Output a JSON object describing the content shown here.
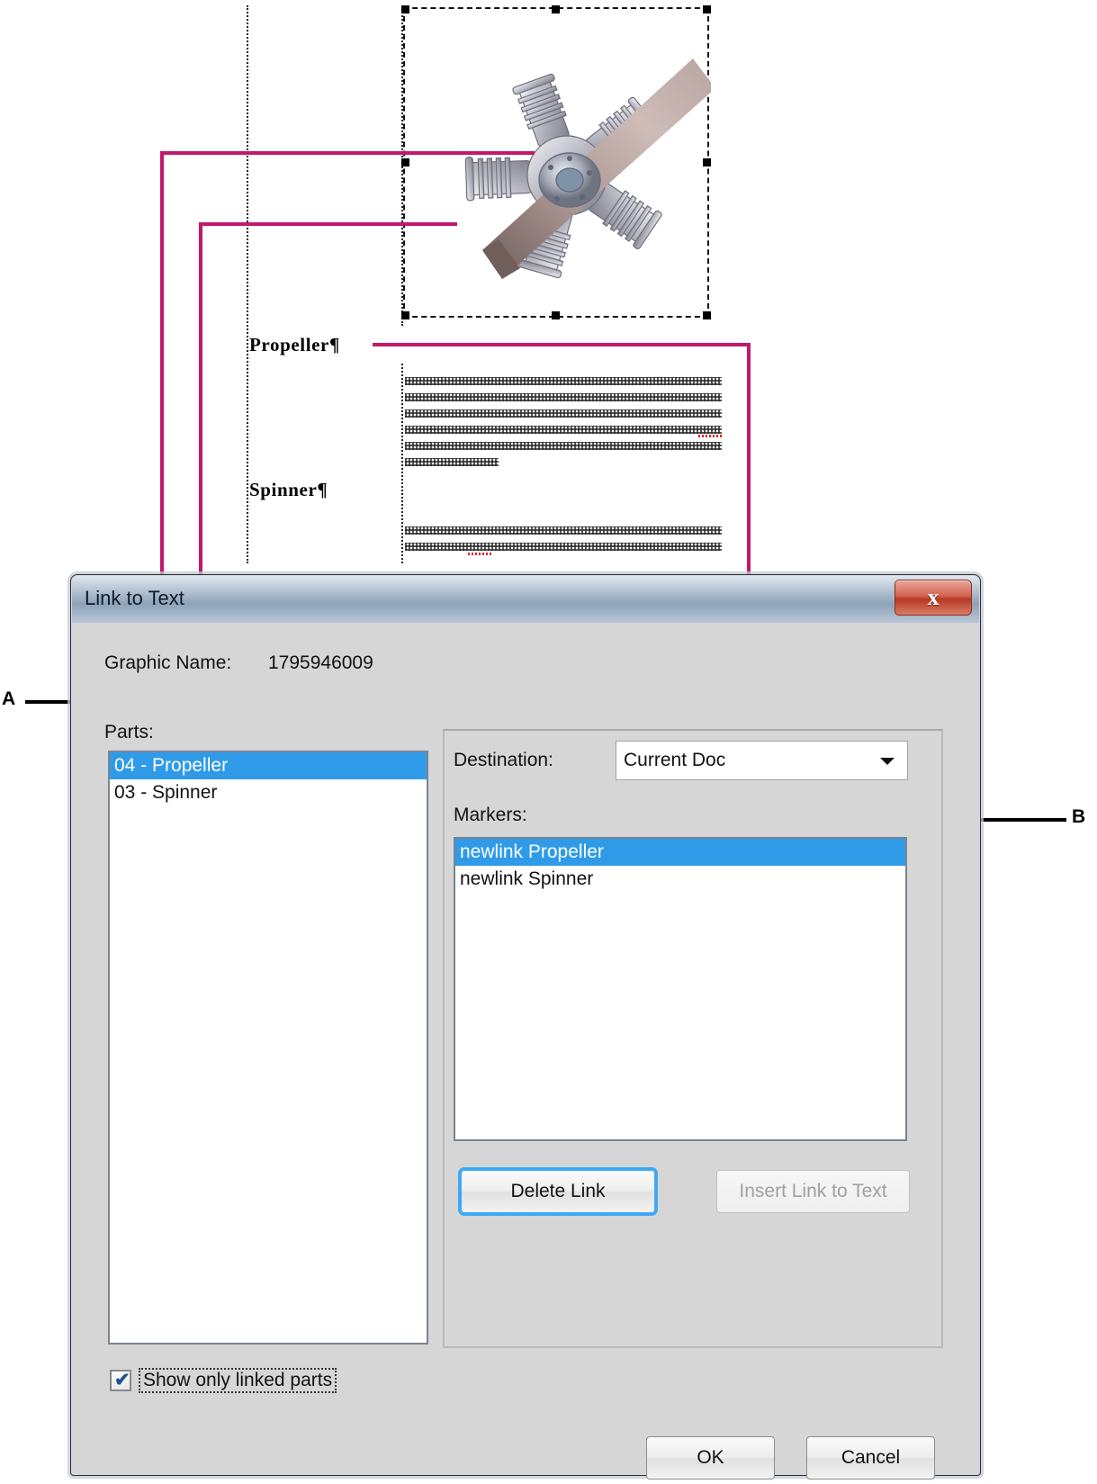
{
  "document": {
    "headings": [
      {
        "text": "Propeller",
        "pilcrow": "¶"
      },
      {
        "text": "Spinner",
        "pilcrow": "¶"
      }
    ],
    "graphic_alt": "radial-engine-propeller-3d-graphic"
  },
  "callouts": [
    {
      "id": "A",
      "label": "A",
      "points_to": "Parts list"
    },
    {
      "id": "B",
      "label": "B",
      "points_to": "Markers list"
    }
  ],
  "dialog": {
    "title": "Link to Text",
    "close_label": "x",
    "graphic_name_label": "Graphic Name:",
    "graphic_name_value": "1795946009",
    "parts_label": "Parts:",
    "parts": [
      {
        "label": "04 - Propeller",
        "selected": true
      },
      {
        "label": "03 - Spinner",
        "selected": false
      }
    ],
    "destination_label": "Destination:",
    "destination_value": "Current Doc",
    "markers_label": "Markers:",
    "markers": [
      {
        "label": "newlink Propeller",
        "selected": true
      },
      {
        "label": "newlink Spinner",
        "selected": false
      }
    ],
    "delete_link_label": "Delete Link",
    "insert_link_label": "Insert Link to Text",
    "show_only_linked_label": "Show only linked parts",
    "show_only_linked_checked": true,
    "check_glyph": "✔",
    "ok_label": "OK",
    "cancel_label": "Cancel"
  },
  "colors": {
    "accent_magenta": "#c2186c",
    "selection_blue": "#2f9be8",
    "dialog_face": "#d6d6d6",
    "focus_blue": "#3fa9f5"
  }
}
